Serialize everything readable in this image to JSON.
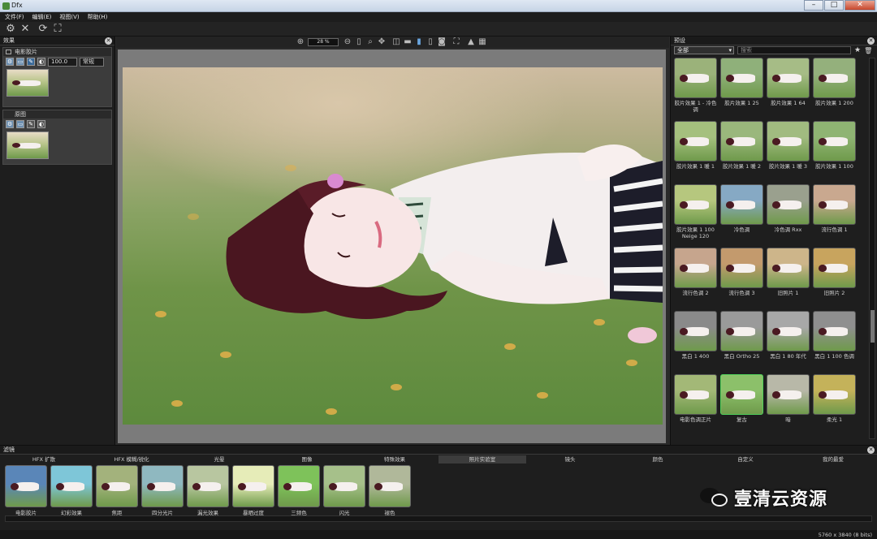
{
  "window": {
    "title": "Dfx"
  },
  "menu": [
    "文件(F)",
    "编辑(E)",
    "视图(V)",
    "帮助(H)"
  ],
  "left": {
    "header": "效果",
    "group1_title": "电影胶片",
    "group1_value": "100.0",
    "group1_mode": "常规",
    "group2_title": "原图"
  },
  "view": {
    "zoom": "28 %"
  },
  "right": {
    "header": "预设",
    "filter": "全部",
    "search_placeholder": "搜索",
    "presets": [
      "胶片效果 1 - 冷色调",
      "胶片效果 1 25",
      "胶片效果 1 64",
      "胶片效果 1 200",
      "胶片效果 1 暖 1",
      "胶片效果 1 暖 2",
      "胶片效果 1 暖 3",
      "胶片效果 1 100",
      "胶片效果 1 100 Neige 120",
      "冷色调",
      "冷色调 Rxx",
      "流行色调 1",
      "流行色调 2",
      "流行色调 3",
      "旧照片 1",
      "旧照片 2",
      "黑白 1 400",
      "黑白 Ortho 25",
      "黑白 1 80 年代",
      "黑白 1 100 色调",
      "电影色调正片",
      "复古",
      "暗",
      "柔光 1"
    ]
  },
  "bottom": {
    "header": "滤镜",
    "categories": [
      "HFX 扩散",
      "HFX 模糊/锐化",
      "光晕",
      "图像",
      "特殊效果",
      "照片实验室",
      "镜头",
      "颜色",
      "自定义",
      "我的最爱"
    ],
    "active_category": 5,
    "thumbs": [
      "电影胶片",
      "幻彩效果",
      "焦距",
      "四分光片",
      "漏光效果",
      "暴晒过度",
      "三频色",
      "闪光",
      "褪色"
    ],
    "status": "5760 x 3840 (8 bits)"
  },
  "watermark": {
    "text": "壹清云资源"
  }
}
